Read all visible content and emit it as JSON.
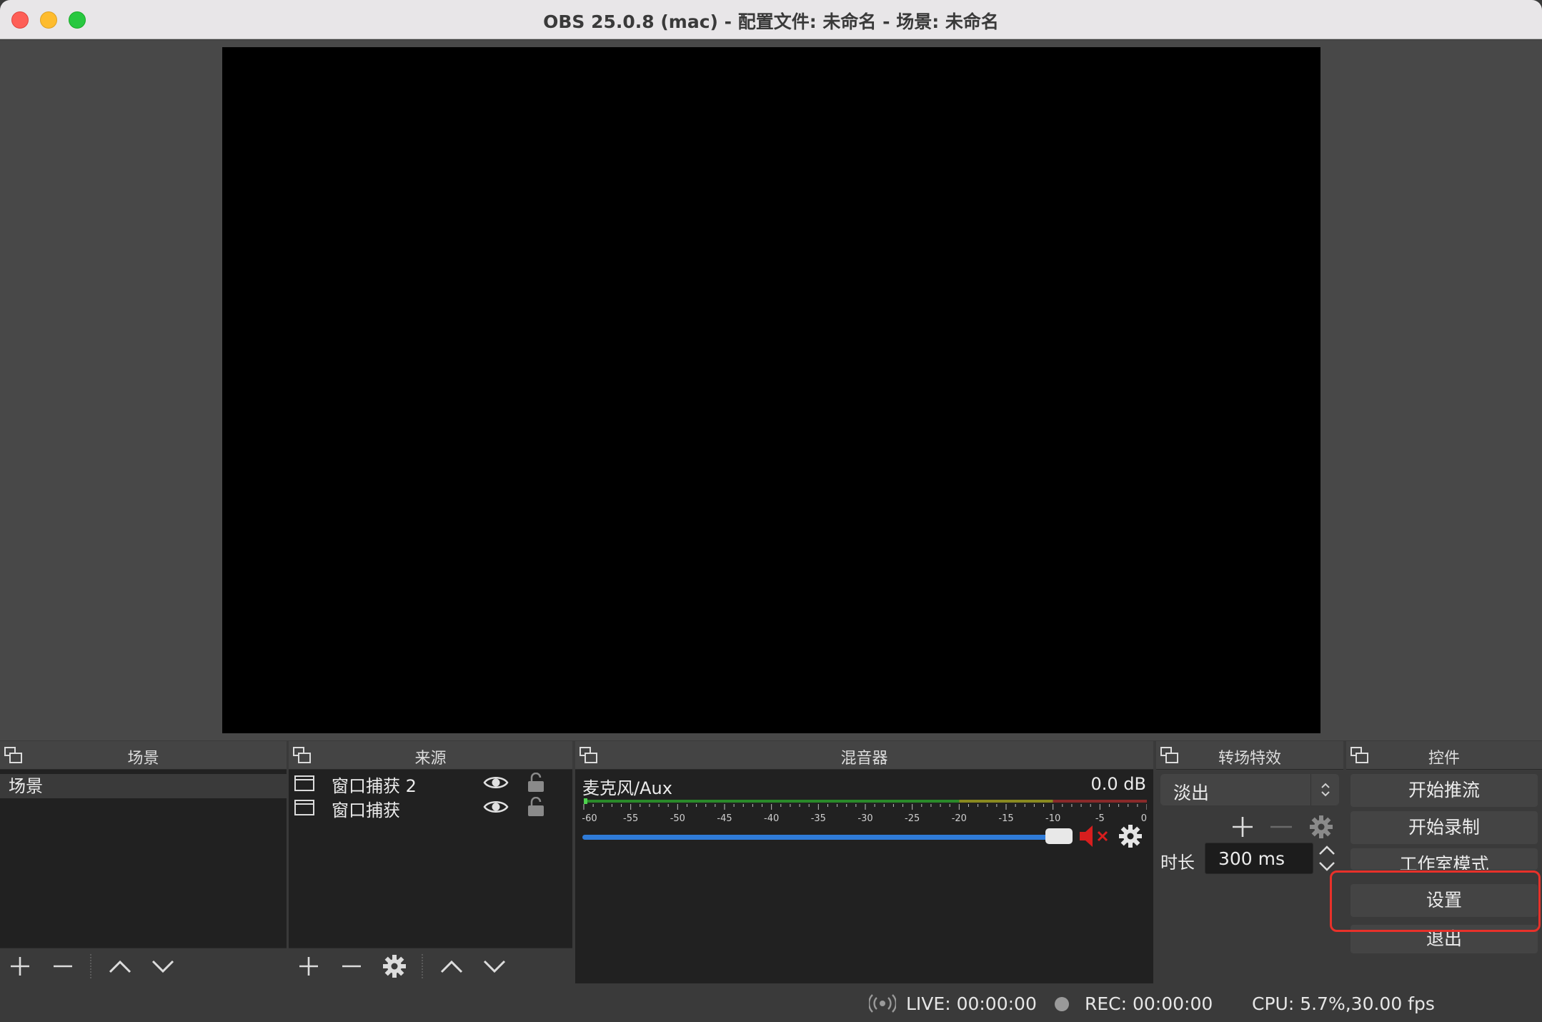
{
  "window": {
    "title": "OBS 25.0.8 (mac) - 配置文件: 未命名 - 场景: 未命名"
  },
  "docks": {
    "scenes": {
      "title": "场景",
      "items": [
        "场景"
      ]
    },
    "sources": {
      "title": "来源",
      "items": [
        {
          "label": "窗口捕获 2"
        },
        {
          "label": "窗口捕获"
        }
      ]
    },
    "mixer": {
      "title": "混音器",
      "channel_name": "麦克风/Aux",
      "level": "0.0 dB",
      "volume_fraction": 1.0,
      "muted": true,
      "scale_labels": [
        "-60",
        "-55",
        "-50",
        "-45",
        "-40",
        "-35",
        "-30",
        "-25",
        "-20",
        "-15",
        "-10",
        "-5",
        "0"
      ]
    },
    "transitions": {
      "title": "转场特效",
      "selected": "淡出",
      "duration_label": "时长",
      "duration_value": "300 ms"
    },
    "controls": {
      "title": "控件",
      "buttons": [
        "开始推流",
        "开始录制",
        "工作室模式",
        "设置",
        "退出"
      ]
    }
  },
  "status": {
    "live": "LIVE: 00:00:00",
    "rec": "REC: 00:00:00",
    "cpu": "CPU: 5.7%,30.00 fps"
  },
  "colors": {
    "highlight": "#e8312a",
    "volume_bar": "#2f7bd8",
    "mute": "#d81e1e"
  }
}
